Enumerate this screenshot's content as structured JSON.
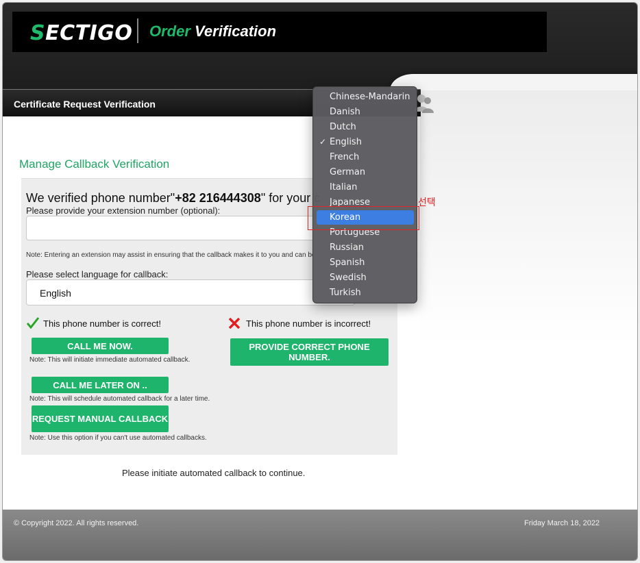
{
  "header": {
    "logo_text": "ECTIGO",
    "logo_s": "S",
    "title_accent": "Order",
    "title_rest": "Verification"
  },
  "title_bar": {
    "text": "Certificate Request Verification"
  },
  "section_title": "Manage Callback Verification",
  "verify": {
    "prefix": "We verified phone number\"",
    "phone": "+82 216444308",
    "suffix": "\" for your c",
    "ext_label": "Please provide your extension number (optional):",
    "ext_value": "",
    "ext_note": "Note: Entering an extension may assist in ensuring that the callback makes it to you and can be c",
    "lang_label": "Please select language for callback:",
    "lang_selected": "English"
  },
  "actions": {
    "correct_label": "This phone number is correct!",
    "incorrect_label": "This phone number is incorrect!",
    "call_now": "CALL ME NOW.",
    "call_now_note": "Note: This will initiate immediate automated callback.",
    "call_later": "CALL ME LATER ON ..",
    "call_later_note": "Note: This will schedule automated callback for a later time.",
    "manual": "REQUEST MANUAL CALLBACK",
    "manual_note": "Note: Use this option if you can't use automated callbacks.",
    "correct_phone": "PROVIDE CORRECT PHONE NUMBER."
  },
  "continue_text": "Please initiate automated callback to continue.",
  "footer": {
    "copyright": "© Copyright 2022. All rights reserved.",
    "date": "Friday March 18, 2022"
  },
  "dropdown": {
    "items": [
      "Chinese-Mandarin",
      "Danish",
      "Dutch",
      "English",
      "French",
      "German",
      "Italian",
      "Japanese",
      "Korean",
      "Portuguese",
      "Russian",
      "Spanish",
      "Swedish",
      "Turkish"
    ],
    "checked": "English",
    "highlighted": "Korean",
    "check_mark": "✓"
  },
  "annotation": {
    "text": "선택",
    "color": "#e02424"
  },
  "colors": {
    "brand_green": "#1fb46b",
    "highlight_blue": "#3d7ee3"
  }
}
